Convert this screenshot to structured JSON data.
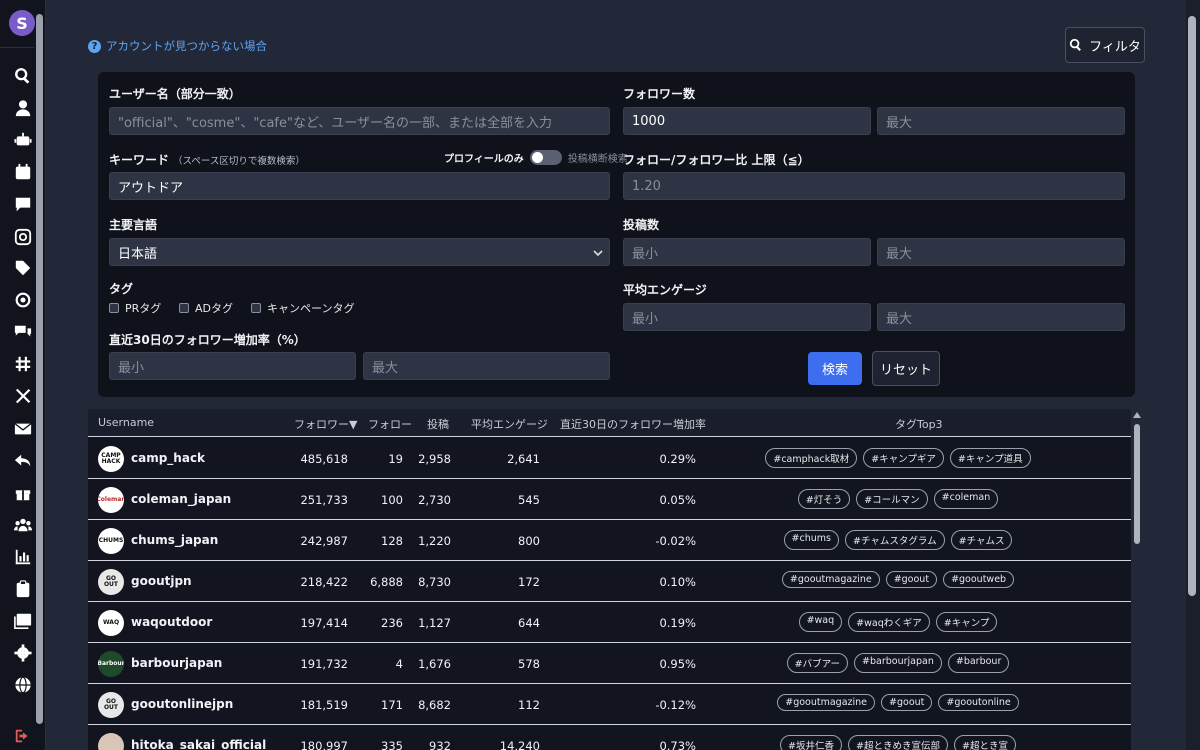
{
  "help_link": "アカウントが見つからない場合",
  "filter_button": "フィルタ",
  "form": {
    "username_label": "ユーザー名（部分一致）",
    "username_placeholder": "\"official\"、\"cosme\"、\"cafe\"など、ユーザー名の一部、または全部を入力",
    "keyword_label": "キーワード",
    "keyword_note": "（スペース区切りで複数検索）",
    "profile_only": "プロフィールのみ",
    "post_search": "投稿横断検索",
    "keyword_value": "アウトドア",
    "language_label": "主要言語",
    "language_value": "日本語",
    "tag_label": "タグ",
    "tag_pr": "PRタグ",
    "tag_ad": "ADタグ",
    "tag_campaign": "キャンペーンタグ",
    "growth_label": "直近30日のフォロワー増加率（%）",
    "followers_label": "フォロワー数",
    "followers_min_value": "1000",
    "ratio_label": "フォロー/フォロワー比 上限（≦）",
    "ratio_placeholder": "1.20",
    "posts_label": "投稿数",
    "engage_label": "平均エンゲージ",
    "min_placeholder": "最小",
    "max_placeholder": "最大",
    "search_button": "検索",
    "reset_button": "リセット"
  },
  "table": {
    "headers": {
      "username": "Username",
      "followers": "フォロワー▼",
      "following": "フォロー",
      "posts": "投稿",
      "engage": "平均エンゲージ",
      "growth": "直近30日のフォロワー増加率",
      "tags": "タグTop3"
    },
    "rows": [
      {
        "avatar": "CAMP HACK",
        "username": "camp_hack",
        "followers": "485,618",
        "following": "19",
        "posts": "2,958",
        "engage": "2,641",
        "growth": "0.29%",
        "tags": [
          "#camphack取材",
          "#キャンプギア",
          "#キャンプ道具"
        ]
      },
      {
        "avatar": "Coleman",
        "username": "coleman_japan",
        "followers": "251,733",
        "following": "100",
        "posts": "2,730",
        "engage": "545",
        "growth": "0.05%",
        "tags": [
          "#灯そう",
          "#コールマン",
          "#coleman"
        ]
      },
      {
        "avatar": "CHUMS",
        "username": "chums_japan",
        "followers": "242,987",
        "following": "128",
        "posts": "1,220",
        "engage": "800",
        "growth": "-0.02%",
        "tags": [
          "#chums",
          "#チャムスタグラム",
          "#チャムス"
        ]
      },
      {
        "avatar": "GO OUT",
        "username": "gooutjpn",
        "followers": "218,422",
        "following": "6,888",
        "posts": "8,730",
        "engage": "172",
        "growth": "0.10%",
        "tags": [
          "#gooutmagazine",
          "#goout",
          "#gooutweb"
        ]
      },
      {
        "avatar": "WAQ",
        "username": "waqoutdoor",
        "followers": "197,414",
        "following": "236",
        "posts": "1,127",
        "engage": "644",
        "growth": "0.19%",
        "tags": [
          "#waq",
          "#waqわくギア",
          "#キャンプ"
        ]
      },
      {
        "avatar": "Barbour",
        "username": "barbourjapan",
        "followers": "191,732",
        "following": "4",
        "posts": "1,676",
        "engage": "578",
        "growth": "0.95%",
        "tags": [
          "#バブアー",
          "#barbourjapan",
          "#barbour"
        ]
      },
      {
        "avatar": "GO OUT",
        "username": "gooutonlinejpn",
        "followers": "181,519",
        "following": "171",
        "posts": "8,682",
        "engage": "112",
        "growth": "-0.12%",
        "tags": [
          "#gooutmagazine",
          "#goout",
          "#gooutonline"
        ]
      },
      {
        "avatar": "",
        "username": "hitoka_sakai_official",
        "followers": "180,997",
        "following": "335",
        "posts": "932",
        "engage": "14,240",
        "growth": "0.73%",
        "tags": [
          "#坂井仁香",
          "#超ときめき宣伝部",
          "#超とき宣"
        ]
      }
    ]
  }
}
